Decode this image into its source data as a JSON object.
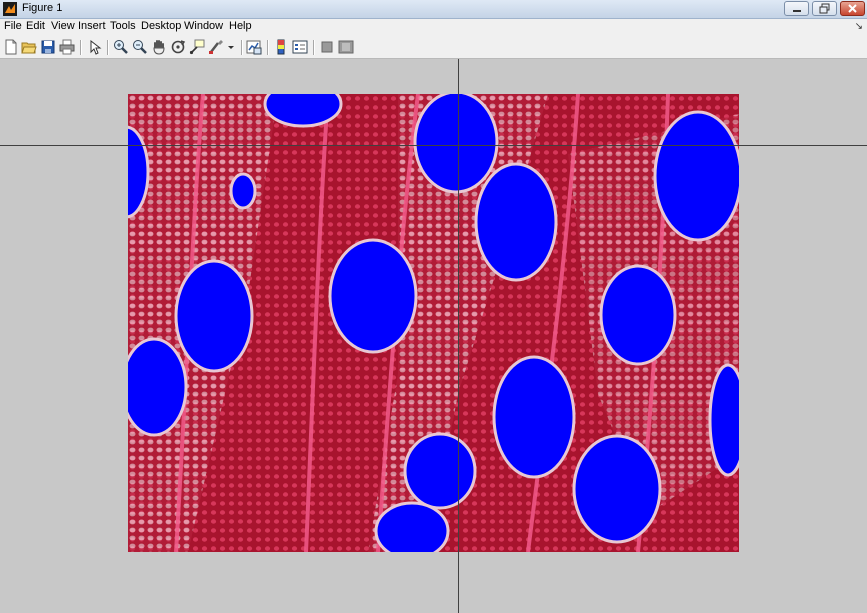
{
  "window": {
    "title": "Figure 1",
    "icon": "matlab-figure-icon"
  },
  "menu": [
    "File",
    "Edit",
    "View",
    "Insert",
    "Tools",
    "Desktop",
    "Window",
    "Help"
  ],
  "toolbar": {
    "tools": [
      "new-figure-icon",
      "open-file-icon",
      "save-icon",
      "print-icon",
      "edit-plot-arrow-icon",
      "zoom-in-icon",
      "zoom-out-icon",
      "pan-hand-icon",
      "rotate-3d-icon",
      "data-cursor-icon",
      "brush-icon",
      "brush-dropdown-icon",
      "link-plot-icon",
      "insert-colorbar-icon",
      "insert-legend-icon",
      "hide-plot-tools-icon",
      "show-plot-tools-icon"
    ]
  },
  "image": {
    "content": "stained wood cross-section with vessel pores masked in blue",
    "tissue_color": "#b01832",
    "mask_color": "#0000ff"
  },
  "crosshair": {
    "color": "#404040"
  }
}
